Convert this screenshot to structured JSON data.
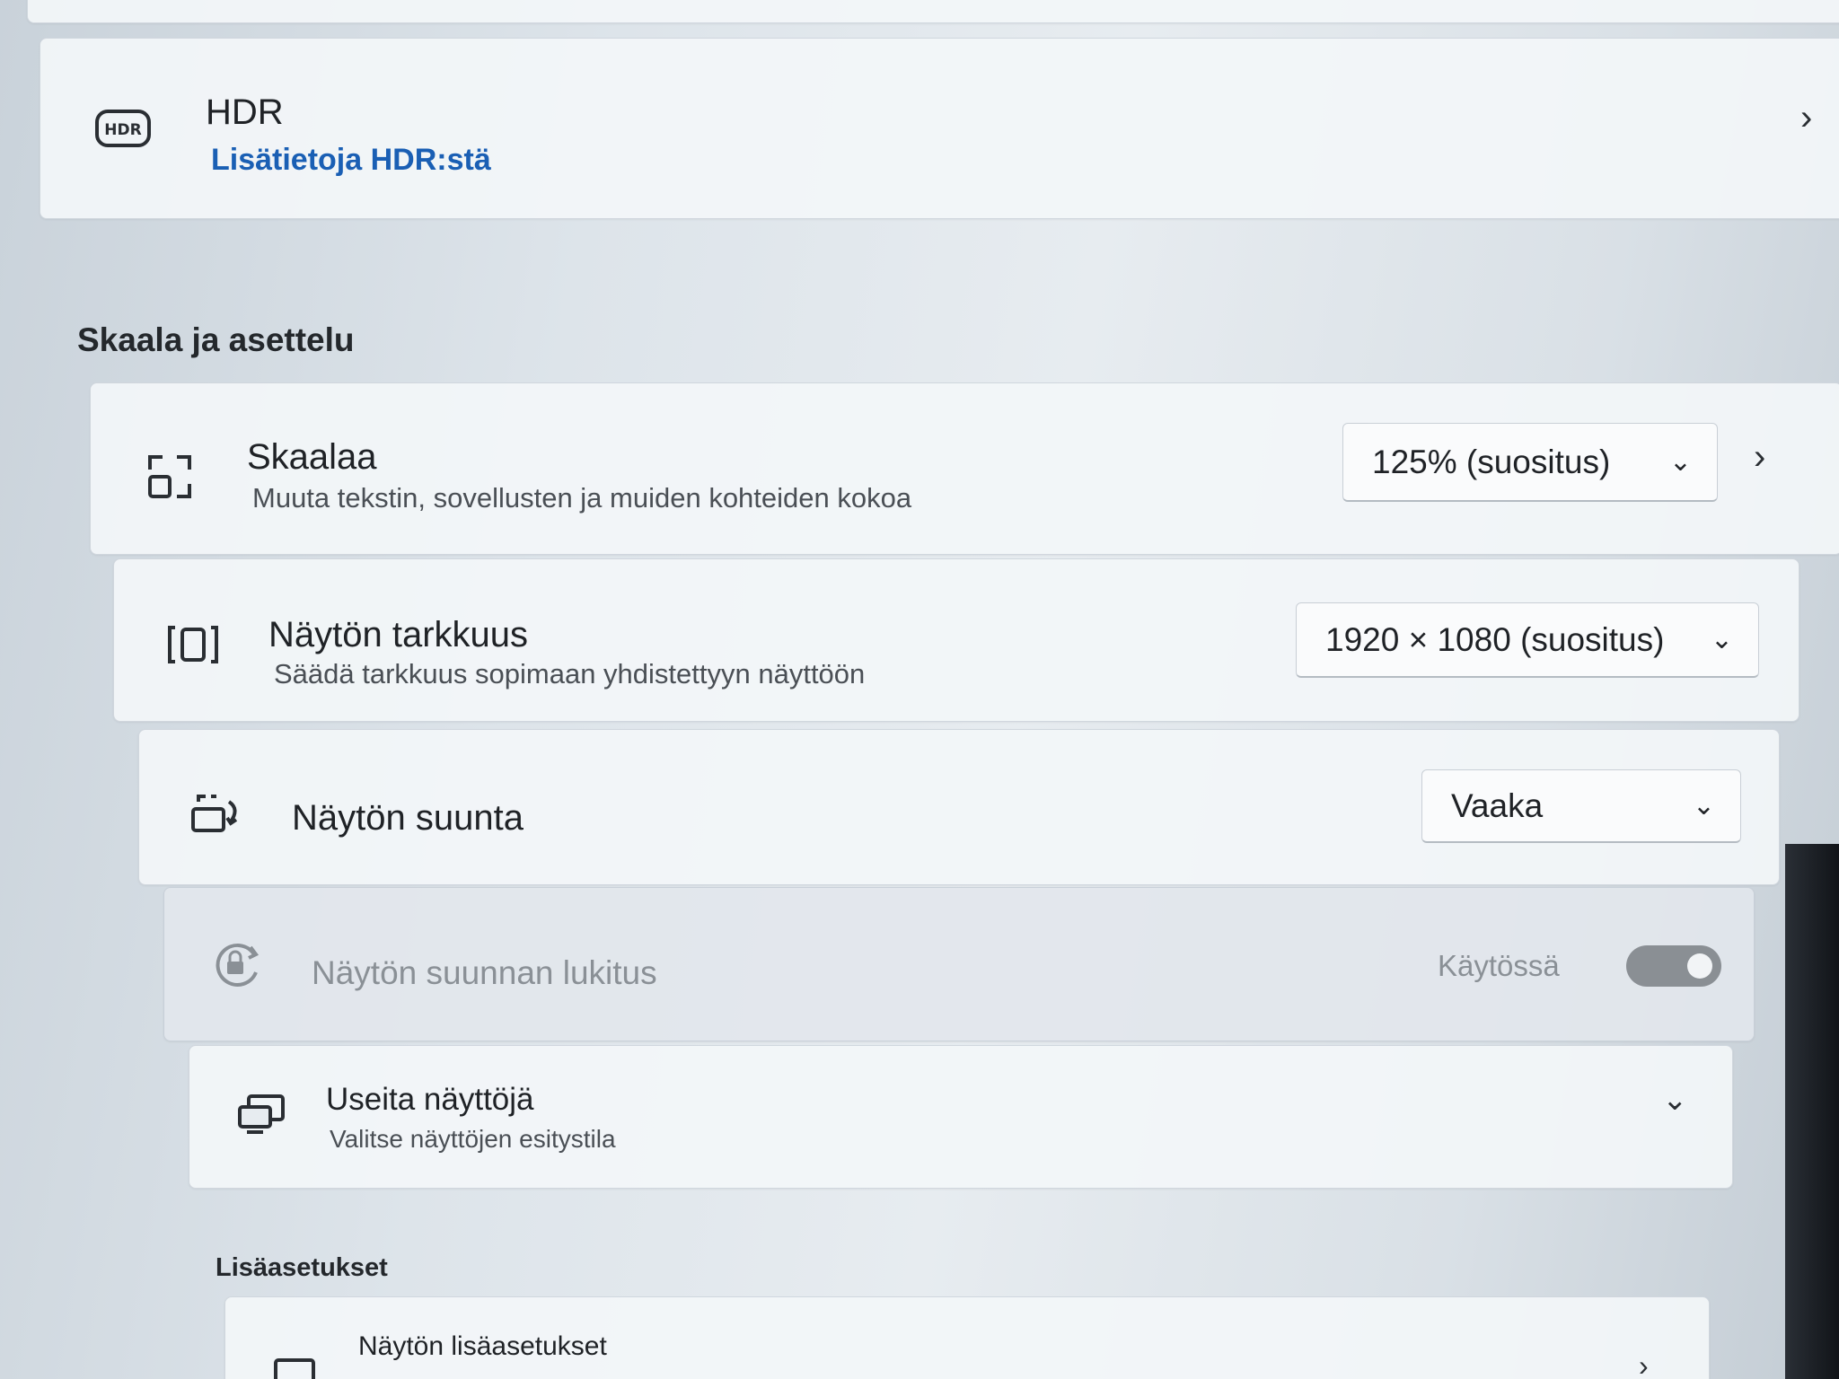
{
  "hdr": {
    "title": "HDR",
    "link": "Lisätietoja HDR:stä",
    "icon": "hdr-icon"
  },
  "scale_layout": {
    "section_title": "Skaala ja asettelu",
    "scale": {
      "title": "Skaalaa",
      "subtitle": "Muuta tekstin, sovellusten ja muiden kohteiden kokoa",
      "value": "125% (suositus)"
    },
    "resolution": {
      "title": "Näytön tarkkuus",
      "subtitle": "Säädä tarkkuus sopimaan yhdistettyyn näyttöön",
      "value": "1920 × 1080 (suositus)"
    },
    "orientation": {
      "title": "Näytön suunta",
      "value": "Vaaka"
    },
    "rotation_lock": {
      "title": "Näytön suunnan lukitus",
      "state_label": "Käytössä",
      "enabled": true
    },
    "multiple_displays": {
      "title": "Useita näyttöjä",
      "subtitle": "Valitse näyttöjen esitystila"
    }
  },
  "advanced": {
    "section_title": "Lisäasetukset",
    "advanced_display": {
      "title": "Näytön lisäasetukset"
    }
  },
  "colors": {
    "accent": "#1a5fb4",
    "toggle": "#8a8f94"
  }
}
